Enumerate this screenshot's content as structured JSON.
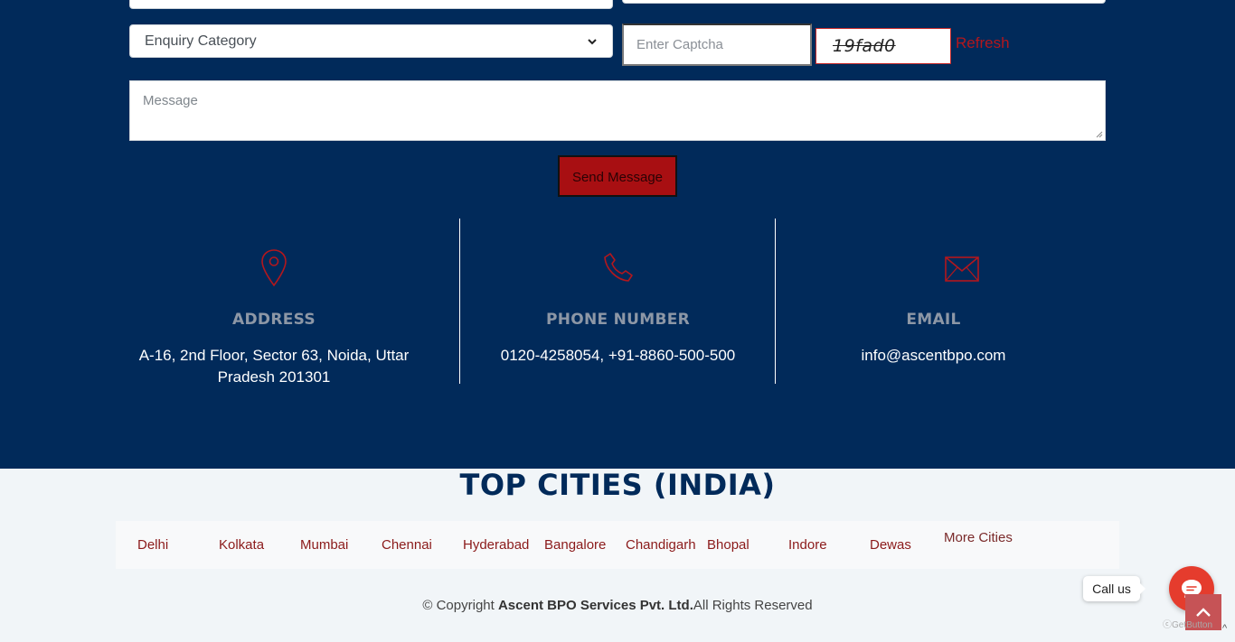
{
  "form": {
    "category_label": "Enquiry Category",
    "captcha_placeholder": "Enter Captcha",
    "captcha_code": "19fad0",
    "refresh_label": "Refresh",
    "message_placeholder": "Message",
    "send_label": "Send Message"
  },
  "contact_info": {
    "address": {
      "title": "ADDRESS",
      "text": "A-16, 2nd Floor, Sector 63, Noida, Uttar Pradesh 201301",
      "icon": "map-pin-icon"
    },
    "phone": {
      "title": "PHONE NUMBER",
      "text": "0120-4258054, +91-8860-500-500",
      "icon": "phone-icon"
    },
    "email": {
      "title": "EMAIL",
      "text": "info@ascentbpo.com",
      "icon": "envelope-icon"
    }
  },
  "cities": {
    "heading": "TOP CITIES (INDIA)",
    "items": [
      "Delhi",
      "Kolkata",
      "Mumbai",
      "Chennai",
      "Hyderabad",
      "Bangalore",
      "Chandigarh",
      "Bhopal",
      "Indore",
      "Dewas"
    ],
    "more_label": "More Cities"
  },
  "footer": {
    "copyright_prefix": "© Copyright ",
    "company": "Ascent BPO Services Pvt. Ltd.",
    "rights": "All Rights Reserved"
  },
  "widgets": {
    "call_label": "Call us",
    "getbutton_label": "GetButton",
    "caret": "^"
  },
  "colors": {
    "navy": "#012a5a",
    "accent_red": "#a80f12",
    "chat_red": "#e53c2d"
  }
}
